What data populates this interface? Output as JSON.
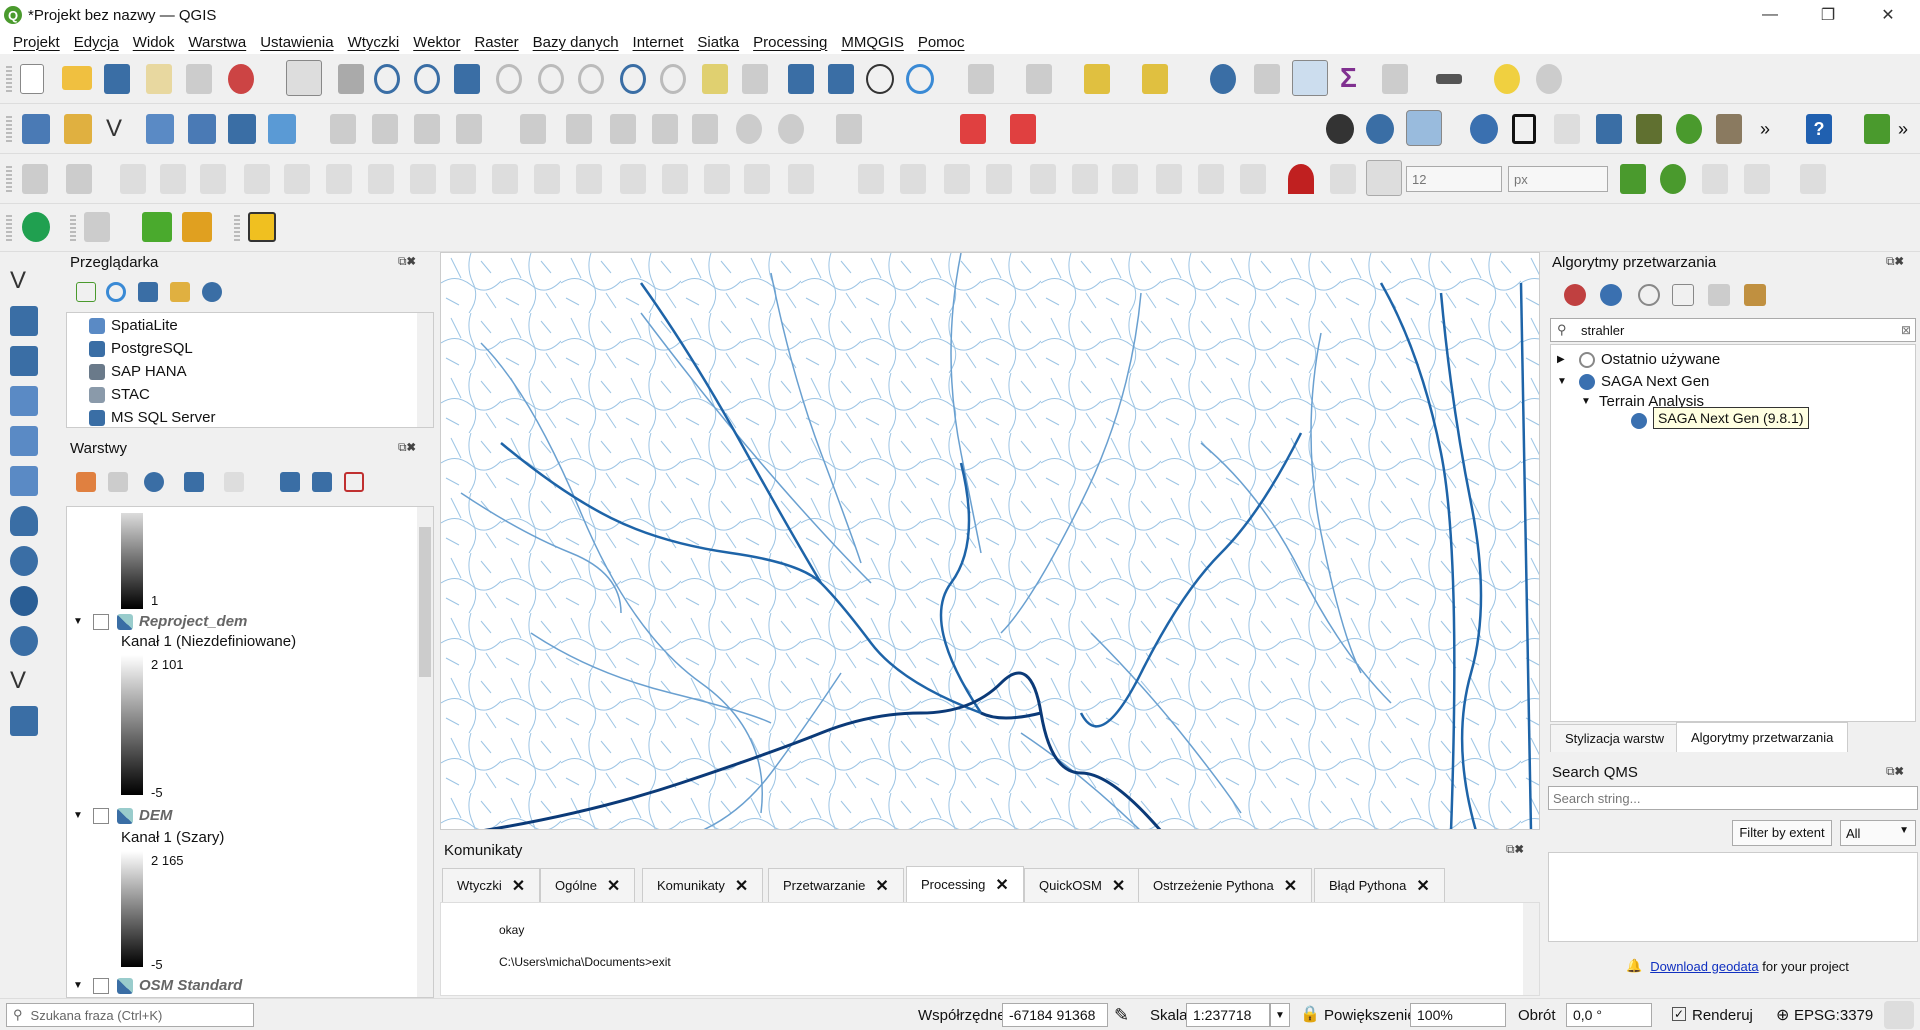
{
  "window": {
    "title": "*Projekt bez nazwy — QGIS",
    "minimize": "—",
    "restore": "❐",
    "close": "✕"
  },
  "menu": [
    "Projekt",
    "Edycja",
    "Widok",
    "Warstwa",
    "Ustawienia",
    "Wtyczki",
    "Wektor",
    "Raster",
    "Bazy danych",
    "Internet",
    "Siatka",
    "Processing",
    "MMQGIS",
    "Pomoc"
  ],
  "toolbar": {
    "snap_tolerance": "12",
    "snap_unit": "px",
    "more": "»"
  },
  "browser": {
    "title": "Przeglądarka",
    "items": [
      "SpatiaLite",
      "PostgreSQL",
      "SAP HANA",
      "STAC",
      "MS SQL Server"
    ]
  },
  "layers": {
    "title": "Warstwy",
    "first_ramp_min": "1",
    "items": [
      {
        "name": "Reproject_dem",
        "band": "Kanał 1 (Niezdefiniowane)",
        "max": "2 101",
        "min": "-5"
      },
      {
        "name": "DEM",
        "band": "Kanał 1 (Szary)",
        "max": "2 165",
        "min": "-5"
      },
      {
        "name": "OSM Standard"
      }
    ]
  },
  "processing": {
    "title": "Algorytmy przetwarzania",
    "search_value": "strahler",
    "tree": [
      "Ostatnio używane",
      "SAGA Next Gen",
      "Terrain Analysis"
    ],
    "tooltip": "SAGA Next Gen (9.8.1)",
    "tabs": [
      "Stylizacja warstw",
      "Algorytmy przetwarzania"
    ]
  },
  "qms": {
    "title": "Search QMS",
    "placeholder": "Search string...",
    "filter_button": "Filter by extent",
    "filter_value": "All",
    "download_link": "Download geodata",
    "download_suffix": " for your project"
  },
  "messages": {
    "title": "Komunikaty",
    "tabs": [
      "Wtyczki",
      "Ogólne",
      "Komunikaty",
      "Przetwarzanie",
      "Processing",
      "QuickOSM",
      "Ostrzeżenie Pythona",
      "Błąd Pythona"
    ],
    "active_tab": "Processing",
    "lines": [
      "okay",
      "C:\\Users\\micha\\Documents>exit"
    ]
  },
  "status": {
    "search_placeholder": "Szukana fraza (Ctrl+K)",
    "coords_label": "Współrzędne",
    "coords_value": "-67184  91368",
    "scale_label": "Skala",
    "scale_value": "1:237718",
    "magnifier_label": "Powiększenie",
    "magnifier_value": "100%",
    "rotation_label": "Obrót",
    "rotation_value": "0,0 °",
    "render_label": "Renderuj",
    "crs": "EPSG:3379"
  },
  "colors": {
    "river_dark": "#0b4a8a",
    "river_light": "#9cc4e4",
    "qgis_green": "#4a9a2d"
  }
}
